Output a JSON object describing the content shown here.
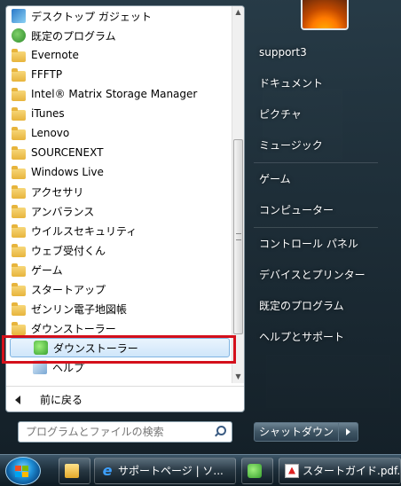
{
  "programs": [
    {
      "label": "デスクトップ ガジェット",
      "icon": "gadget-icon"
    },
    {
      "label": "既定のプログラム",
      "icon": "default-programs-icon"
    },
    {
      "label": "Evernote",
      "icon": "folder-icon"
    },
    {
      "label": "FFFTP",
      "icon": "folder-icon"
    },
    {
      "label": "Intel® Matrix Storage Manager",
      "icon": "folder-icon"
    },
    {
      "label": "iTunes",
      "icon": "folder-icon"
    },
    {
      "label": "Lenovo",
      "icon": "folder-icon"
    },
    {
      "label": "SOURCENEXT",
      "icon": "folder-icon"
    },
    {
      "label": "Windows Live",
      "icon": "folder-icon"
    },
    {
      "label": "アクセサリ",
      "icon": "folder-icon"
    },
    {
      "label": "アンバランス",
      "icon": "folder-icon"
    },
    {
      "label": "ウイルスセキュリティ",
      "icon": "folder-icon"
    },
    {
      "label": "ウェブ受付くん",
      "icon": "folder-icon"
    },
    {
      "label": "ゲーム",
      "icon": "folder-icon"
    },
    {
      "label": "スタートアップ",
      "icon": "folder-icon"
    },
    {
      "label": "ゼンリン電子地図帳",
      "icon": "folder-icon"
    },
    {
      "label": "ダウンストーラー",
      "icon": "folder-icon"
    },
    {
      "label": "ダウンストーラー",
      "icon": "downloader-app-icon",
      "highlighted": true
    },
    {
      "label": "ヘルプ",
      "icon": "help-app-icon"
    }
  ],
  "back_label": "前に戻る",
  "search": {
    "placeholder": "プログラムとファイルの検索"
  },
  "right_pane": {
    "user": "support3",
    "items": [
      "ドキュメント",
      "ピクチャ",
      "ミュージック",
      "ゲーム",
      "コンピューター",
      "コントロール パネル",
      "デバイスとプリンター",
      "既定のプログラム",
      "ヘルプとサポート"
    ]
  },
  "shutdown_label": "シャットダウン",
  "taskbar": {
    "ie_window": "サポートページ | ソ...",
    "pdf_window": "スタートガイド.pdf..."
  },
  "colors": {
    "highlight_border": "#d4101b",
    "selection_bg": "#cfe6fa"
  }
}
